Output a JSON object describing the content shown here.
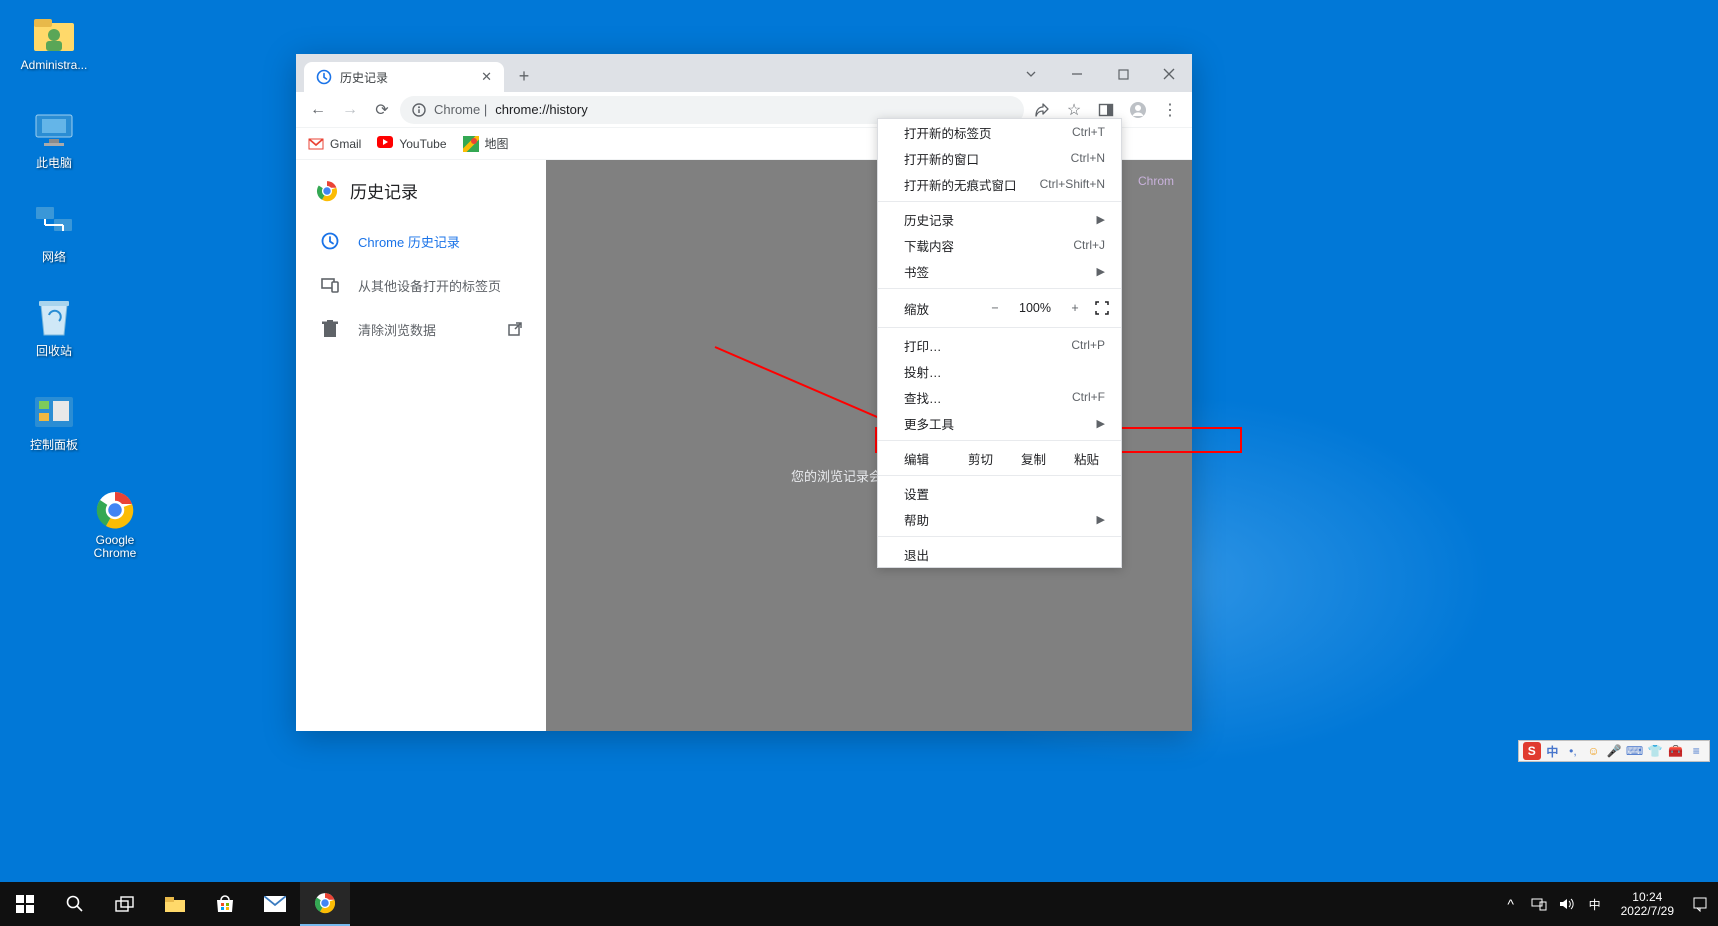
{
  "desktop": {
    "icons": [
      {
        "name": "admin",
        "label": "Administra..."
      },
      {
        "name": "this-pc",
        "label": "此电脑"
      },
      {
        "name": "network",
        "label": "网络"
      },
      {
        "name": "recycle",
        "label": "回收站"
      },
      {
        "name": "control-panel",
        "label": "控制面板"
      },
      {
        "name": "chrome",
        "label": "Google Chrome"
      }
    ]
  },
  "chrome": {
    "tab_title": "历史记录",
    "url_prefix": "Chrome | ",
    "url": "chrome://history",
    "bookmarks": [
      {
        "name": "gmail",
        "label": "Gmail"
      },
      {
        "name": "youtube",
        "label": "YouTube"
      },
      {
        "name": "maps",
        "label": "地图"
      }
    ],
    "history": {
      "title": "历史记录",
      "items": [
        {
          "name": "chrome-history",
          "label": "Chrome 历史记录",
          "active": true
        },
        {
          "name": "other-devices",
          "label": "从其他设备打开的标签页",
          "active": false
        }
      ],
      "clear": "清除浏览数据",
      "empty": "您的浏览记录会显示在此处",
      "search_ghost": "Chrom"
    }
  },
  "menu": {
    "new_tab": {
      "label": "打开新的标签页",
      "shortcut": "Ctrl+T"
    },
    "new_window": {
      "label": "打开新的窗口",
      "shortcut": "Ctrl+N"
    },
    "incognito": {
      "label": "打开新的无痕式窗口",
      "shortcut": "Ctrl+Shift+N"
    },
    "history": {
      "label": "历史记录"
    },
    "downloads": {
      "label": "下载内容",
      "shortcut": "Ctrl+J"
    },
    "bookmarks": {
      "label": "书签"
    },
    "zoom": {
      "label": "缩放",
      "value": "100%",
      "minus": "−",
      "plus": "+"
    },
    "print": {
      "label": "打印…",
      "shortcut": "Ctrl+P"
    },
    "cast": {
      "label": "投射…"
    },
    "find": {
      "label": "查找…",
      "shortcut": "Ctrl+F"
    },
    "more_tools": {
      "label": "更多工具"
    },
    "edit": {
      "label": "编辑",
      "cut": "剪切",
      "copy": "复制",
      "paste": "粘贴"
    },
    "settings": {
      "label": "设置"
    },
    "help": {
      "label": "帮助"
    },
    "exit": {
      "label": "退出"
    }
  },
  "ime": {
    "lang": "中"
  },
  "tray": {
    "lang": "中",
    "time": "10:24",
    "date": "2022/7/29"
  }
}
